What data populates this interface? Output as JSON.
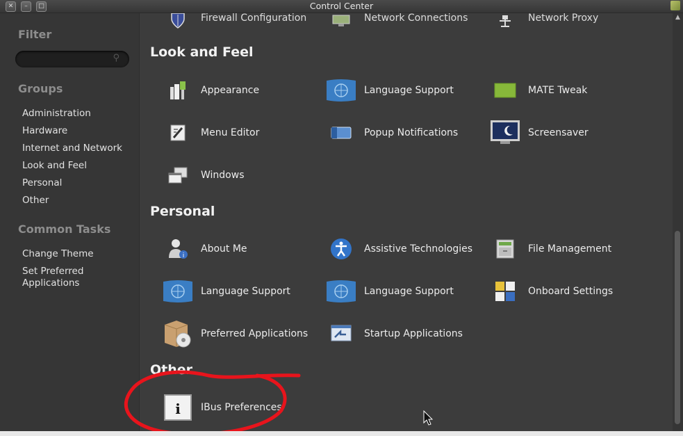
{
  "window": {
    "title": "Control Center"
  },
  "sidebar": {
    "filter_heading": "Filter",
    "groups_heading": "Groups",
    "groups": [
      "Administration",
      "Hardware",
      "Internet and Network",
      "Look and Feel",
      "Personal",
      "Other"
    ],
    "tasks_heading": "Common Tasks",
    "tasks": [
      "Change Theme",
      "Set Preferred Applications"
    ]
  },
  "top_row": [
    "Firewall Configuration",
    "Network Connections",
    "Network Proxy"
  ],
  "sections": {
    "look_and_feel": {
      "title": "Look and Feel",
      "items": [
        "Appearance",
        "Language Support",
        "MATE Tweak",
        "Menu Editor",
        "Popup Notifications",
        "Screensaver",
        "Windows"
      ]
    },
    "personal": {
      "title": "Personal",
      "items": [
        "About Me",
        "Assistive Technologies",
        "File Management",
        "Language Support",
        "Language Support",
        "Onboard Settings",
        "Preferred Applications",
        "Startup Applications"
      ]
    },
    "other": {
      "title": "Other",
      "items": [
        "IBus Preferences"
      ]
    }
  },
  "colors": {
    "annotation": "#e8141c",
    "background": "#3c3c3c",
    "sidebar": "#363636"
  },
  "icons": [
    "shield-icon",
    "network-icon",
    "proxy-icon",
    "appearance-icon",
    "globe-icon",
    "mate-tweak-icon",
    "menu-editor-icon",
    "popup-icon",
    "screensaver-icon",
    "windows-icon",
    "about-me-icon",
    "accessibility-icon",
    "file-manager-icon",
    "onboard-icon",
    "package-icon",
    "startup-icon",
    "info-icon"
  ]
}
